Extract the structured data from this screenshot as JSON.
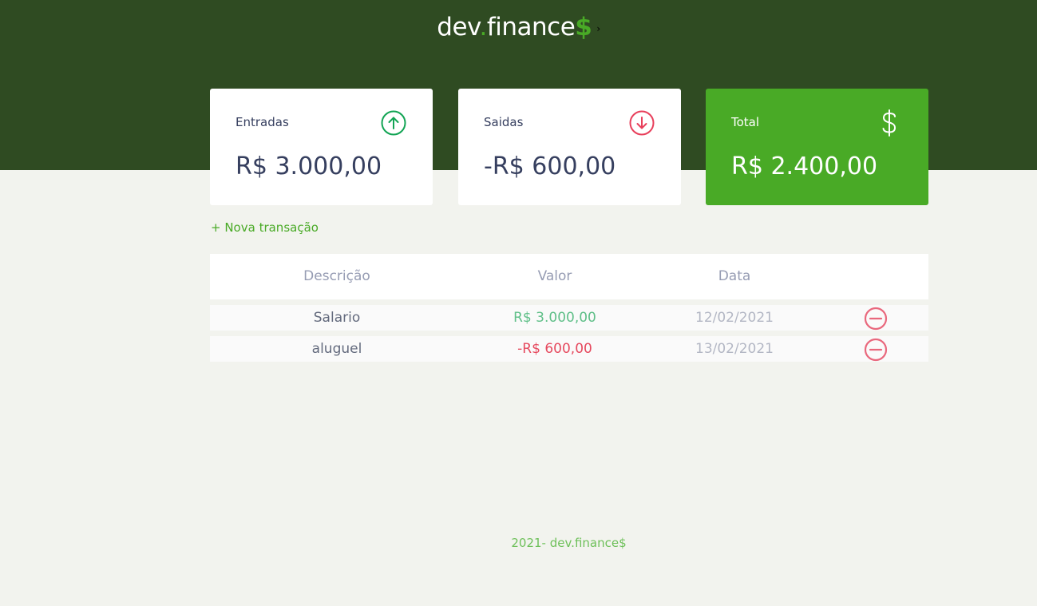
{
  "header": {
    "logo_main": "dev",
    "logo_dot": ".",
    "logo_rest": "finance",
    "logo_dollar": "$",
    "cursor_glyph": "›"
  },
  "cards": [
    {
      "label": "Entradas",
      "value": "R$ 3.000,00",
      "icon": "arrow-up-circle-icon"
    },
    {
      "label": "Saidas",
      "value": "-R$ 600,00",
      "icon": "arrow-down-circle-icon"
    },
    {
      "label": "Total",
      "value": "R$ 2.400,00",
      "icon": "dollar-icon"
    }
  ],
  "actions": {
    "new_transaction": "+ Nova transação"
  },
  "table": {
    "headers": [
      "Descrição",
      "Valor",
      "Data"
    ],
    "rows": [
      {
        "description": "Salario",
        "amount": "R$ 3.000,00",
        "date": "12/02/2021",
        "type": "income"
      },
      {
        "description": "aluguel",
        "amount": "-R$ 600,00",
        "date": "13/02/2021",
        "type": "expense"
      }
    ]
  },
  "footer": {
    "text": "2021- dev.finance$"
  },
  "colors": {
    "header_bg": "#2f4b22",
    "accent_green": "#49aa26",
    "income": "#5fbf88",
    "expense": "#e64a5f"
  }
}
